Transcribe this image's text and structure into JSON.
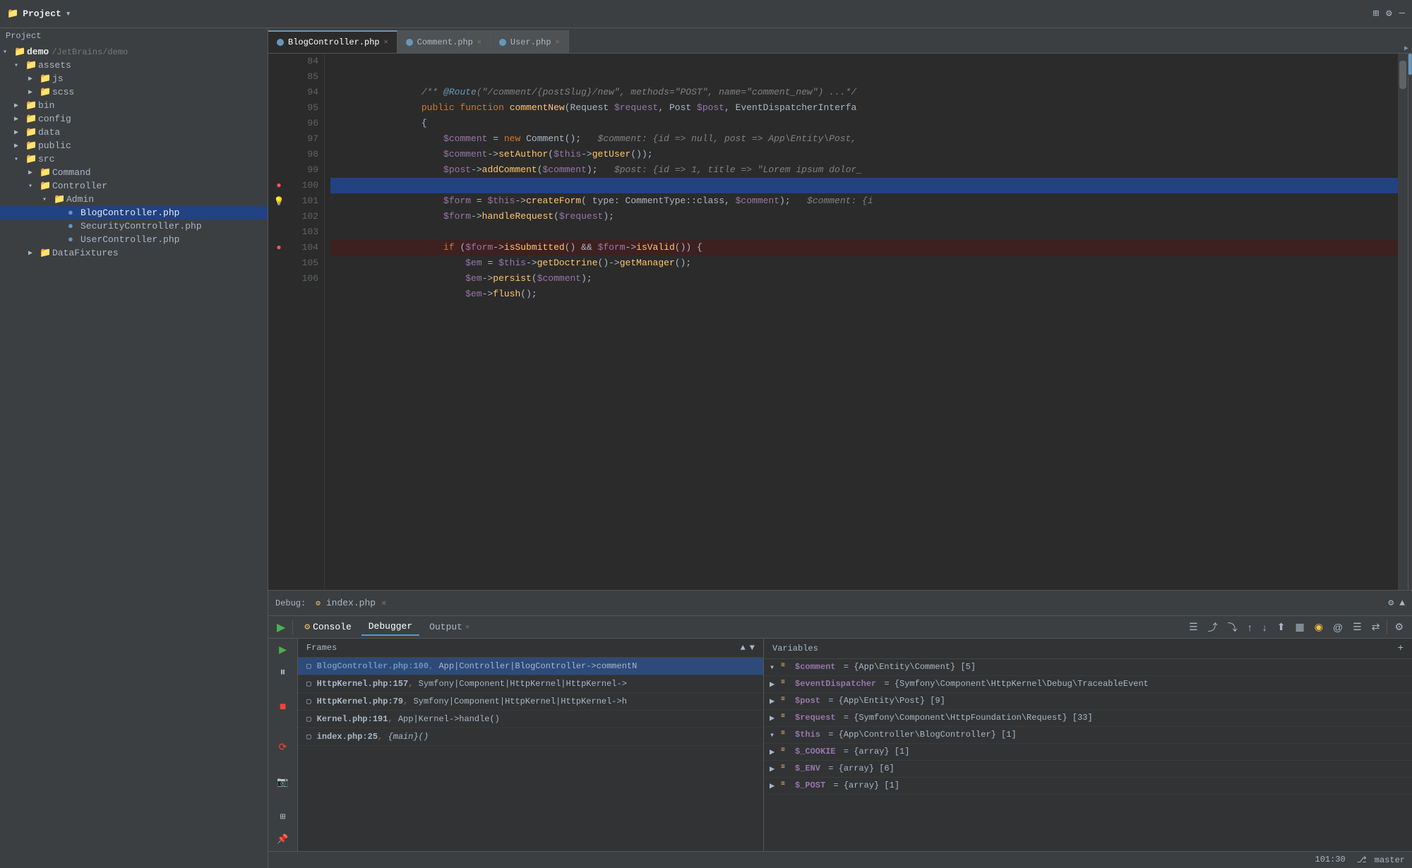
{
  "topbar": {
    "title": "Project",
    "path": "/JetBrains/demo",
    "root": "demo"
  },
  "sidebar": {
    "header": "Project",
    "tree": [
      {
        "id": "demo",
        "label": "demo",
        "indent": 0,
        "type": "root",
        "expanded": true,
        "path": "/JetBrains/demo"
      },
      {
        "id": "assets",
        "label": "assets",
        "indent": 1,
        "type": "folder",
        "expanded": true
      },
      {
        "id": "js",
        "label": "js",
        "indent": 2,
        "type": "folder",
        "expanded": false
      },
      {
        "id": "scss",
        "label": "scss",
        "indent": 2,
        "type": "folder",
        "expanded": false
      },
      {
        "id": "bin",
        "label": "bin",
        "indent": 1,
        "type": "folder",
        "expanded": false
      },
      {
        "id": "config",
        "label": "config",
        "indent": 1,
        "type": "folder",
        "expanded": false
      },
      {
        "id": "data",
        "label": "data",
        "indent": 1,
        "type": "folder",
        "expanded": false
      },
      {
        "id": "public",
        "label": "public",
        "indent": 1,
        "type": "folder",
        "expanded": false
      },
      {
        "id": "src",
        "label": "src",
        "indent": 1,
        "type": "folder",
        "expanded": true
      },
      {
        "id": "Command",
        "label": "Command",
        "indent": 2,
        "type": "folder",
        "expanded": false
      },
      {
        "id": "Controller",
        "label": "Controller",
        "indent": 2,
        "type": "folder",
        "expanded": true
      },
      {
        "id": "Admin",
        "label": "Admin",
        "indent": 3,
        "type": "folder",
        "expanded": true
      },
      {
        "id": "BlogController",
        "label": "BlogController.php",
        "indent": 4,
        "type": "php",
        "selected": true
      },
      {
        "id": "SecurityController",
        "label": "SecurityController.php",
        "indent": 4,
        "type": "php"
      },
      {
        "id": "UserController",
        "label": "UserController.php",
        "indent": 4,
        "type": "php"
      },
      {
        "id": "DataFixtures",
        "label": "DataFixtures",
        "indent": 2,
        "type": "folder",
        "expanded": false
      }
    ]
  },
  "tabs": [
    {
      "id": "blog",
      "label": "BlogController.php",
      "active": true,
      "icon": "php"
    },
    {
      "id": "comment",
      "label": "Comment.php",
      "active": false,
      "icon": "php"
    },
    {
      "id": "user",
      "label": "User.php",
      "active": false,
      "icon": "php"
    }
  ],
  "code": {
    "lines": [
      {
        "num": 84,
        "content": "",
        "gutter": ""
      },
      {
        "num": 85,
        "content": "    /** @Route(\"/comment/{postSlug}/new\", methods=\"POST\", name=\"comment_new\") ...*/",
        "gutter": ""
      },
      {
        "num": 94,
        "content": "    public function commentNew(Request $request, Post $post, EventDispatcherInterfa",
        "gutter": "fold"
      },
      {
        "num": 95,
        "content": "    {",
        "gutter": ""
      },
      {
        "num": 96,
        "content": "        $comment = new Comment();   $comment: {id => null, post => App\\Entity\\Post,",
        "gutter": ""
      },
      {
        "num": 97,
        "content": "        $comment->setAuthor($this->getUser());",
        "gutter": ""
      },
      {
        "num": 98,
        "content": "        $post->addComment($comment);   $post: {id => 1, title => \"Lorem ipsum dolor_",
        "gutter": ""
      },
      {
        "num": 99,
        "content": "",
        "gutter": ""
      },
      {
        "num": 100,
        "content": "        $form = $this->createForm( type: CommentType::class, $comment);   $comment: {i",
        "gutter": "breakpoint",
        "highlighted": true
      },
      {
        "num": 101,
        "content": "        $form->handleRequest($request);",
        "gutter": "lightbulb"
      },
      {
        "num": 102,
        "content": "",
        "gutter": ""
      },
      {
        "num": 103,
        "content": "        if ($form->isSubmitted() && $form->isValid()) {",
        "gutter": "fold"
      },
      {
        "num": 104,
        "content": "            $em = $this->getDoctrine()->getManager();",
        "gutter": "breakpoint",
        "error": true
      },
      {
        "num": 105,
        "content": "            $em->persist($comment);",
        "gutter": ""
      },
      {
        "num": 106,
        "content": "            $em->flush();",
        "gutter": ""
      }
    ]
  },
  "debug": {
    "title": "index.php",
    "tabs": [
      "Console",
      "Debugger",
      "Output"
    ],
    "active_tab": "Debugger",
    "frames_label": "Frames",
    "variables_label": "Variables",
    "frames": [
      {
        "file": "BlogController.php:100",
        "path": "App|Controller|BlogController->commentN",
        "active": true
      },
      {
        "file": "HttpKernel.php:157",
        "path": "Symfony|Component|HttpKernel|HttpKernel->"
      },
      {
        "file": "HttpKernel.php:79",
        "path": "Symfony|Component|HttpKernel|HttpKernel->h"
      },
      {
        "file": "Kernel.php:191",
        "path": "App|Kernel->handle()"
      },
      {
        "file": "index.php:25",
        "path": "{main}()"
      }
    ],
    "variables": [
      {
        "name": "$comment",
        "value": "= {App\\Entity\\Comment} [5]",
        "expanded": true,
        "color": "#9876aa"
      },
      {
        "name": "$eventDispatcher",
        "value": "= {Symfony\\Component\\HttpKernel\\Debug\\TraceableEvent",
        "expanded": false,
        "color": "#9876aa"
      },
      {
        "name": "$post",
        "value": "= {App\\Entity\\Post} [9]",
        "expanded": false,
        "color": "#9876aa"
      },
      {
        "name": "$request",
        "value": "= {Symfony\\Component\\HttpFoundation\\Request} [33]",
        "expanded": false,
        "color": "#9876aa"
      },
      {
        "name": "$this",
        "value": "= {App\\Controller\\BlogController} [1]",
        "expanded": true,
        "color": "#9876aa"
      },
      {
        "name": "$_COOKIE",
        "value": "= {array} [1]",
        "expanded": false,
        "color": "#9876aa"
      },
      {
        "name": "$_ENV",
        "value": "= {array} [6]",
        "expanded": false,
        "color": "#9876aa"
      },
      {
        "name": "$_POST",
        "value": "= {array} [1]",
        "expanded": false,
        "color": "#9876aa"
      }
    ]
  },
  "statusbar": {
    "left": "",
    "time": "101:30",
    "branch": "master"
  }
}
